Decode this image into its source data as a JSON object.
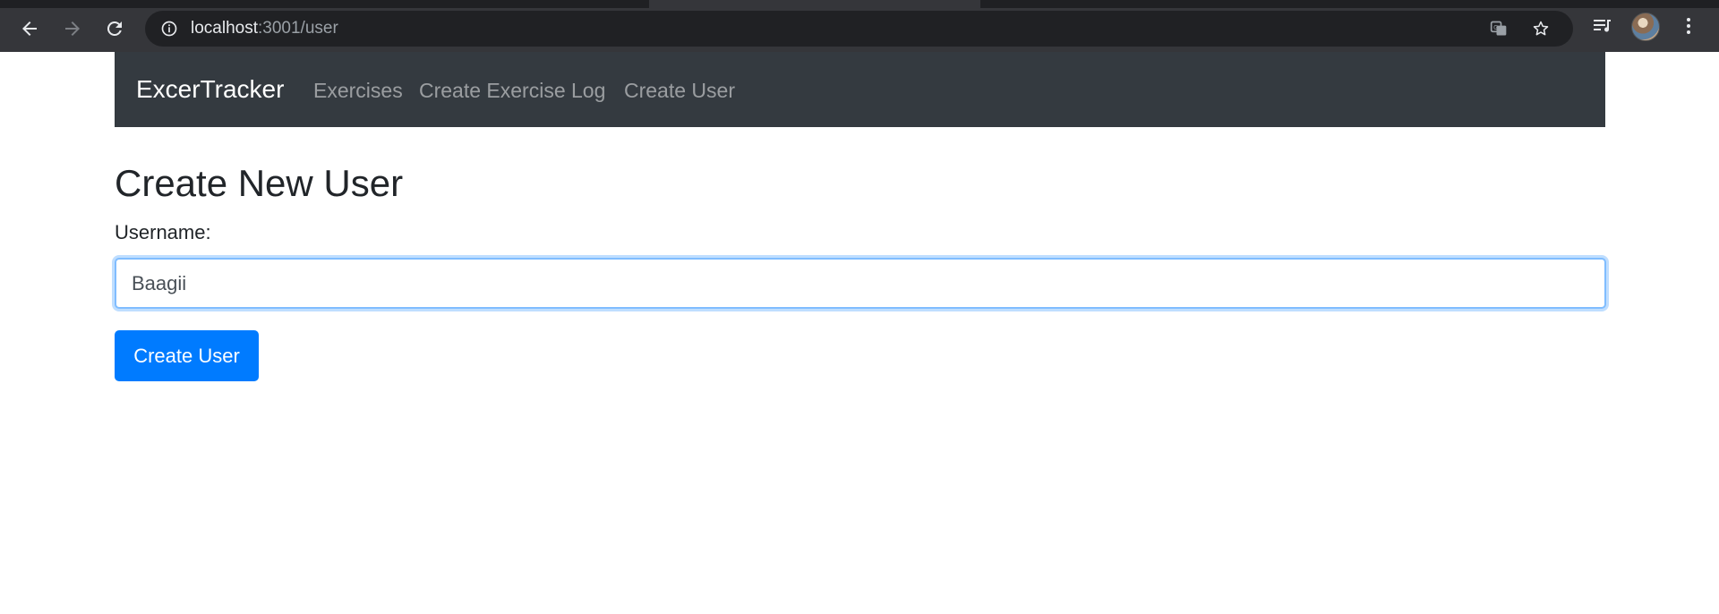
{
  "browser": {
    "url_host": "localhost",
    "url_path": ":3001/user",
    "icons": {
      "back": "back-arrow-icon",
      "forward": "forward-arrow-icon",
      "reload": "reload-icon",
      "info": "info-icon",
      "translate": "translate-icon",
      "bookmark": "star-icon",
      "media": "media-control-icon",
      "profile": "avatar",
      "menu": "kebab-menu-icon"
    }
  },
  "navbar": {
    "brand": "ExcerTracker",
    "links": [
      "Exercises",
      "Create Exercise Log",
      "Create User"
    ]
  },
  "form": {
    "title": "Create New User",
    "username_label": "Username:",
    "username_value": "Baagii",
    "submit_label": "Create User"
  },
  "colors": {
    "navbar_bg": "#343a40",
    "primary": "#007bff",
    "text": "#212529"
  }
}
